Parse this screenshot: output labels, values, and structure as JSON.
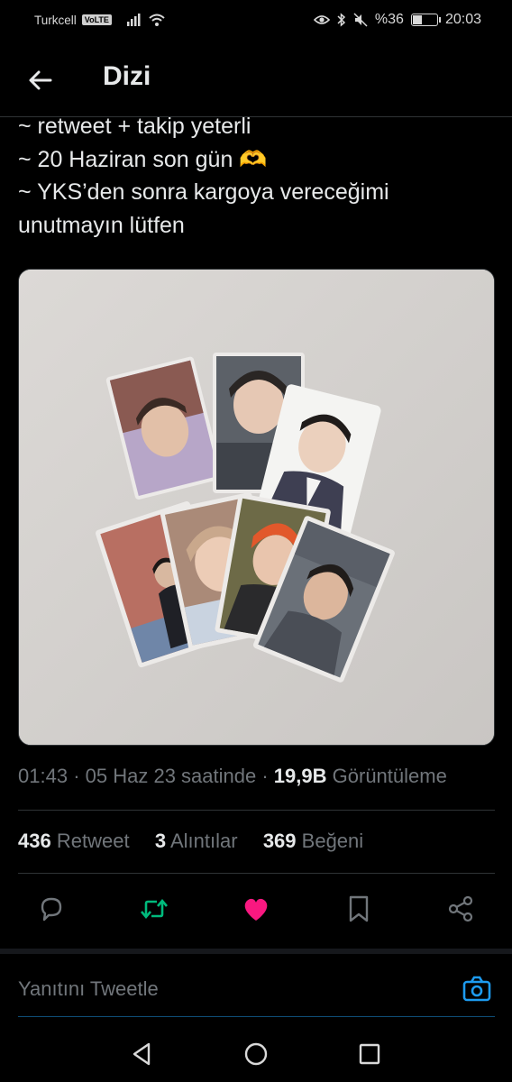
{
  "status_bar": {
    "carrier": "Turkcell",
    "volte": "VoLTE",
    "battery_text": "%36",
    "battery_level": 0.36,
    "time": "20:03"
  },
  "header": {
    "title": "Dizi",
    "back_icon": "arrow-left-icon"
  },
  "tweet": {
    "lines": [
      "~ retweet + takip yeterli",
      "~ 20 Haziran son gün 🫶",
      "~ YKS’den sonra kargoya vereceğimi",
      "unutmayın lütfen"
    ],
    "media_description_icon": "photo",
    "time": "01:43",
    "date": "05 Haz 23 saatinde",
    "views_count": "19,9B",
    "views_label": "Görüntüleme",
    "retweets_count": "436",
    "retweets_label": "Retweet",
    "quotes_count": "3",
    "quotes_label": "Alıntılar",
    "likes_count": "369",
    "likes_label": "Beğeni"
  },
  "actions": {
    "reply_icon": "comment-icon",
    "retweet_icon": "retweet-icon",
    "like_icon": "heart-icon",
    "bookmark_icon": "bookmark-icon",
    "share_icon": "share-icon",
    "retweet_color": "#00ba7c",
    "like_color": "#f91880"
  },
  "composer": {
    "placeholder": "Yanıtını Tweetle",
    "camera_icon": "camera-icon",
    "accent": "#1d9bf0"
  },
  "nav": {
    "back_icon": "triangle-back-icon",
    "home_icon": "circle-home-icon",
    "recents_icon": "square-recents-icon"
  }
}
